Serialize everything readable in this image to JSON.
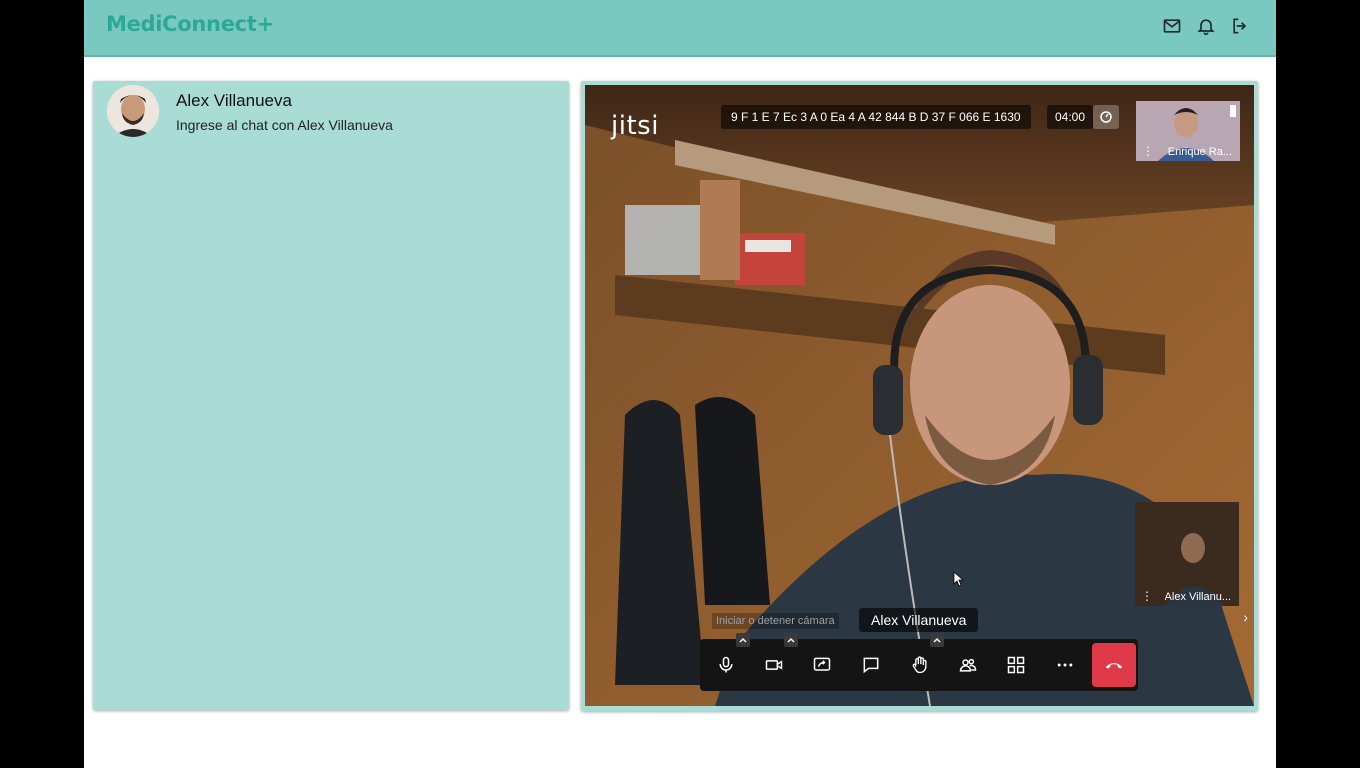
{
  "app": {
    "logo": "MediConnect+"
  },
  "header": {
    "icons": [
      "mail-icon",
      "bell-icon",
      "logout-icon"
    ]
  },
  "chat": {
    "contact_name": "Alex Villanueva",
    "contact_subtitle": "Ingrese al chat con Alex Villanueva"
  },
  "video": {
    "brand": "jitsi",
    "room_id": "9 F 1 E 7 Ec 3 A 0 Ea 4 A 42 844 B D 37 F 066 E 1630",
    "timer": "04:00",
    "remote_thumb_name": "Enrique Ra...",
    "local_thumb_name": "Alex Villanu...",
    "speaker_name": "Alex Villanueva",
    "tooltip": "Iniciar o detener cámara",
    "toolbar": [
      "microphone-icon",
      "camera-icon",
      "screen-share-icon",
      "chat-icon",
      "raise-hand-icon",
      "participants-icon",
      "tile-view-icon",
      "more-icon",
      "hangup-icon"
    ]
  },
  "colors": {
    "accent": "#79c9c0",
    "panel": "#a8dcd5",
    "logo": "#2ba89a",
    "hangup": "#e03a4a"
  }
}
